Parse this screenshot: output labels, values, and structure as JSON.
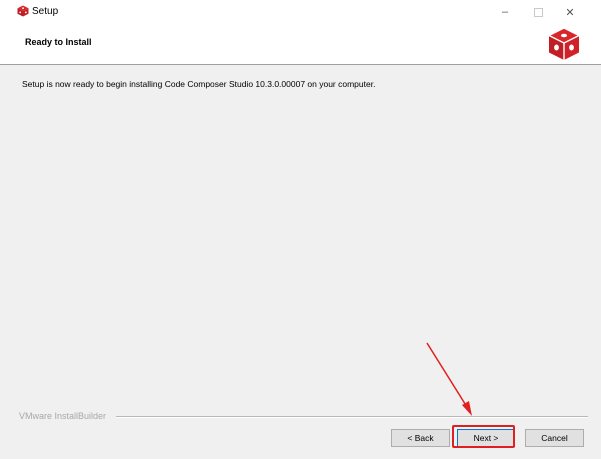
{
  "window": {
    "title": "Setup",
    "minimize_glyph": "–",
    "close_glyph": "✕",
    "app_icon": "red-cube-icon"
  },
  "header": {
    "title": "Ready to Install",
    "logo": "red-cube-logo"
  },
  "body": {
    "message": "Setup is now ready to begin installing Code Composer Studio 10.3.0.00007 on your computer."
  },
  "footer": {
    "brand": "VMware InstallBuilder",
    "back_label": "< Back",
    "next_label": "Next >",
    "cancel_label": "Cancel"
  },
  "colors": {
    "logo_red": "#d9262c",
    "annotation_red": "#e02020",
    "focus_blue": "#0078d7"
  }
}
